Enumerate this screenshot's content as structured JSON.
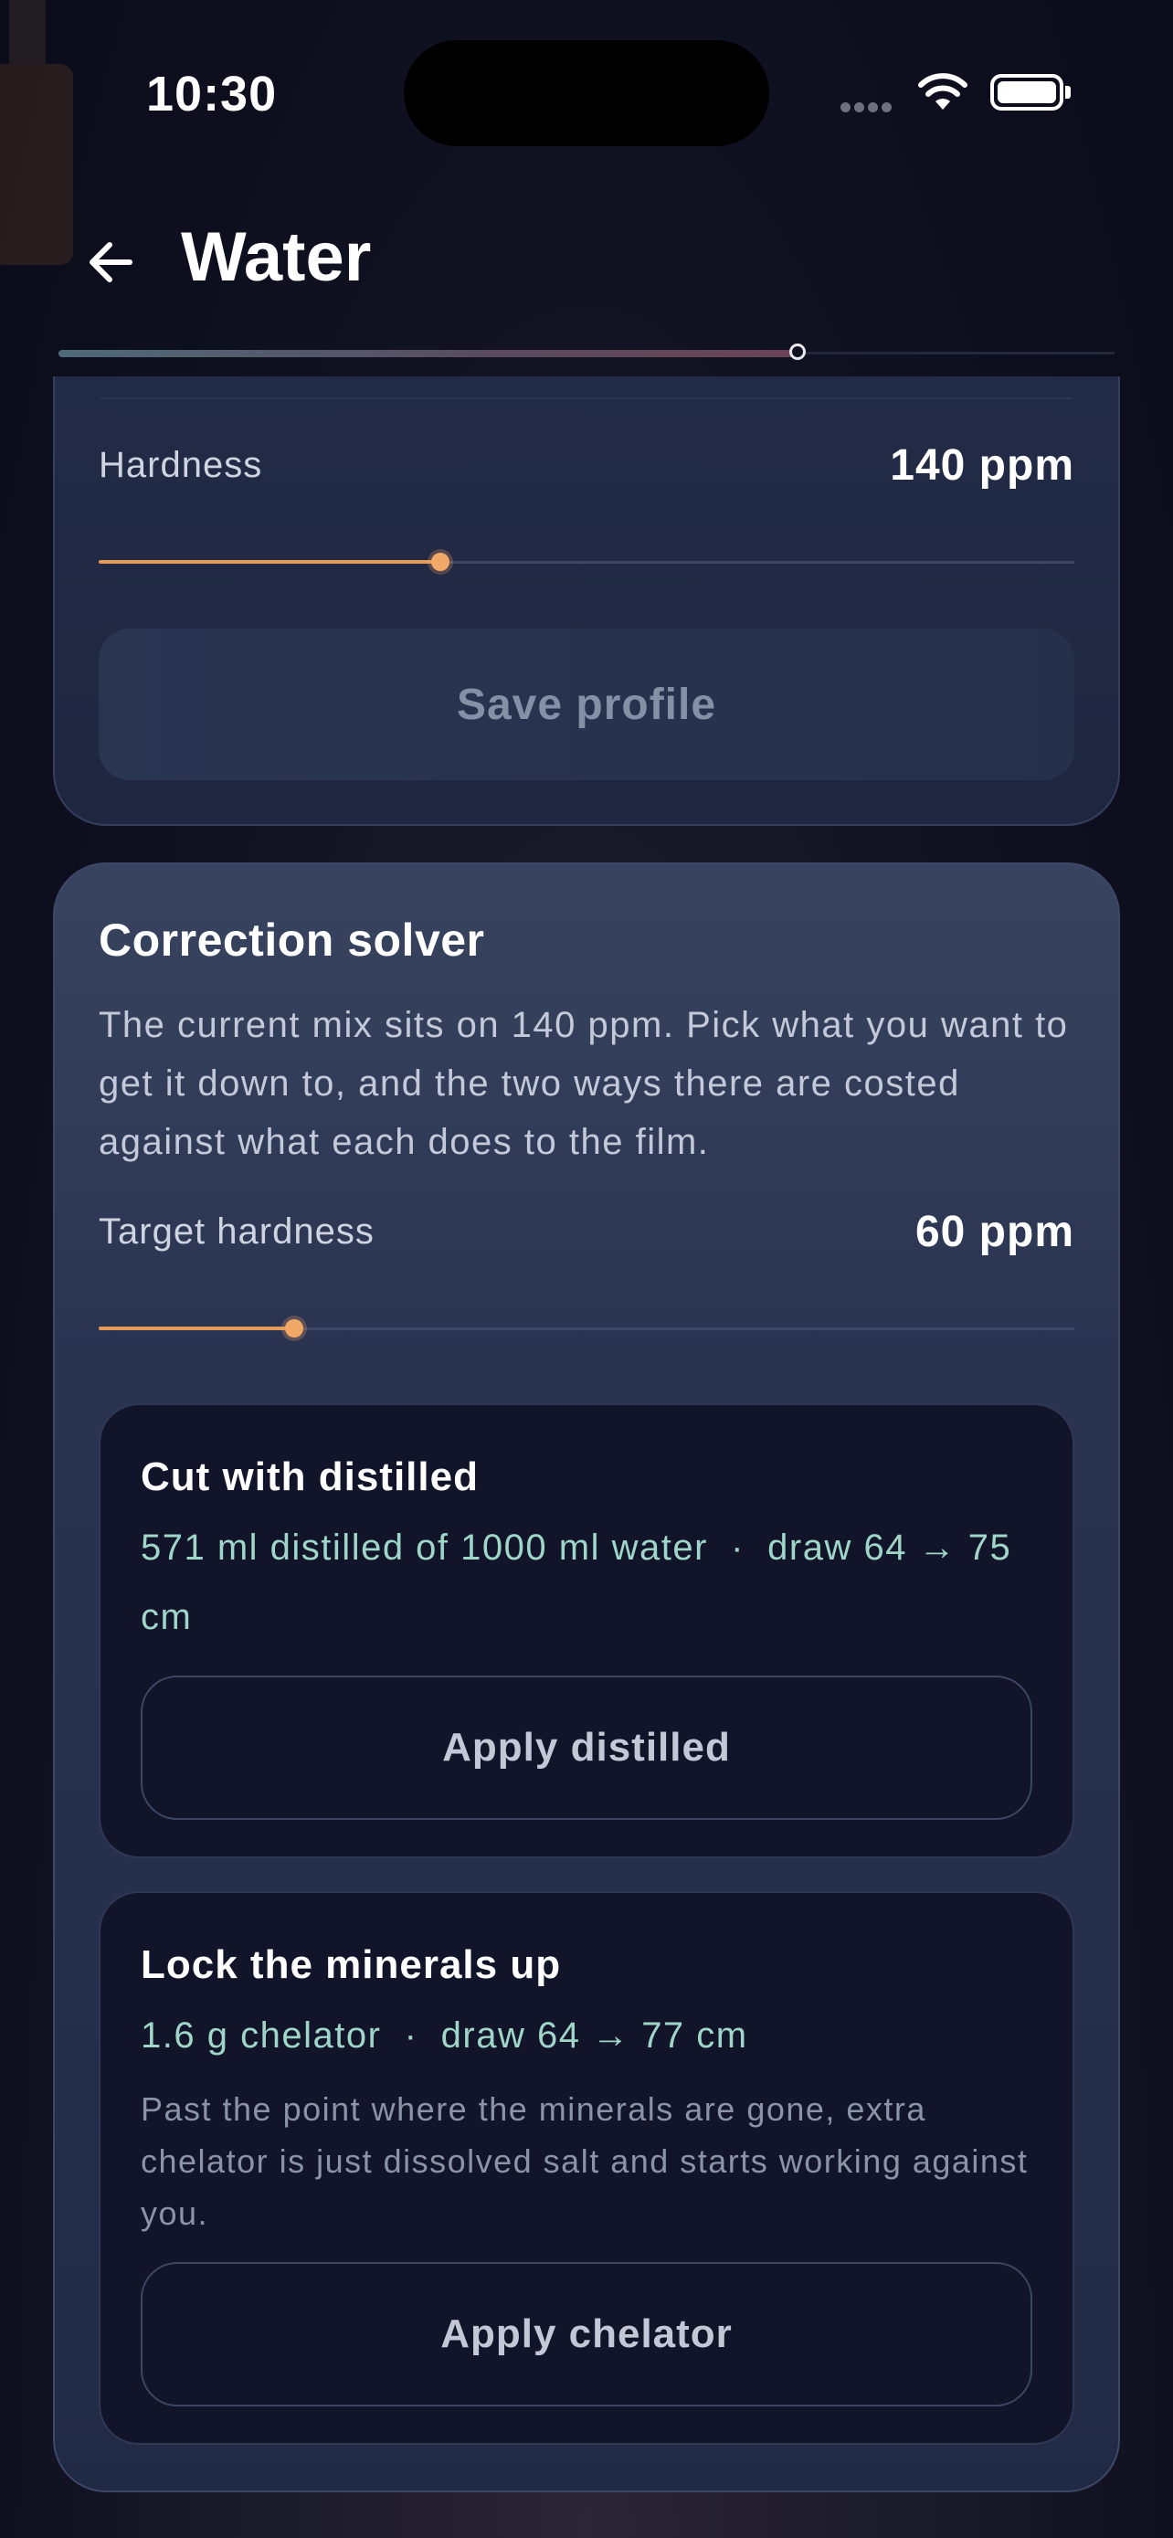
{
  "status_bar": {
    "time": "10:30"
  },
  "header": {
    "title": "Water"
  },
  "progress": {
    "fraction": 0.7
  },
  "profile_card": {
    "hardness_label": "Hardness",
    "hardness_value": "140 ppm",
    "hardness_slider_fraction": 0.35,
    "save_label": "Save profile"
  },
  "solver": {
    "title": "Correction solver",
    "description": "The current mix sits on 140 ppm. Pick what you want to get it down to, and the two ways there are costed against what each does to the film.",
    "target_label": "Target hardness",
    "target_value": "60 ppm",
    "target_slider_fraction": 0.2,
    "options": [
      {
        "title": "Cut with distilled",
        "detail": "571 ml distilled of 1000 ml water  ·  draw 64 → 75 cm",
        "button": "Apply distilled"
      },
      {
        "title": "Lock the minerals up",
        "detail": "1.6 g chelator  ·  draw 64 → 77 cm",
        "note": "Past the point where the minerals are gone, extra chelator is just dissolved salt and starts working against you.",
        "button": "Apply chelator"
      }
    ]
  },
  "colors": {
    "accent": "#e69a58",
    "detail_text": "#9fd6c8",
    "background": "#0f1020"
  },
  "icons": {
    "back": "arrow-left-icon",
    "wifi": "wifi-icon",
    "battery": "battery-icon"
  }
}
